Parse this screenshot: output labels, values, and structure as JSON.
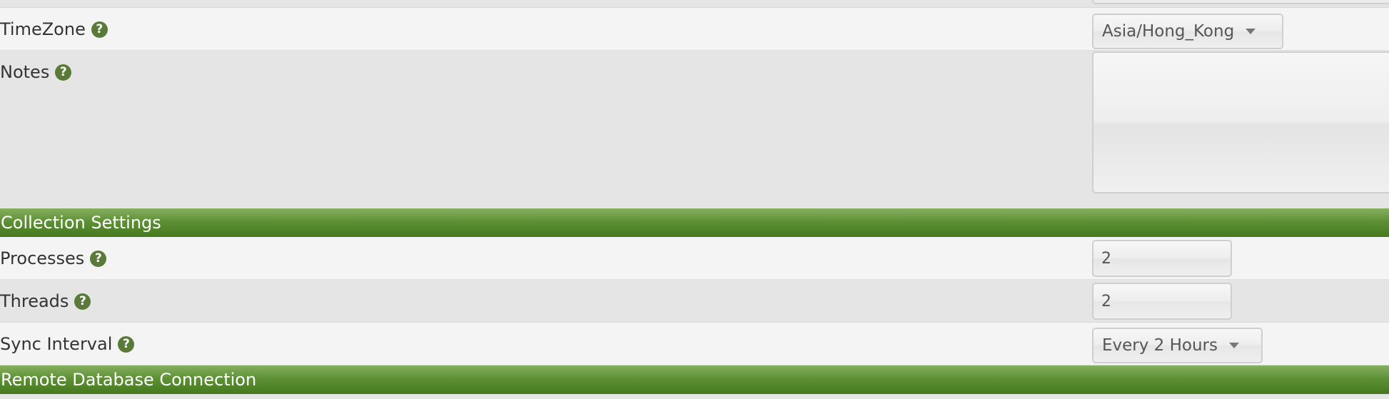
{
  "general": {
    "timezone_label": "TimeZone",
    "timezone_value": "Asia/Hong_Kong",
    "notes_label": "Notes",
    "notes_value": ""
  },
  "collection": {
    "title": "Collection Settings",
    "processes_label": "Processes",
    "processes_value": "2",
    "threads_label": "Threads",
    "threads_value": "2",
    "sync_label": "Sync Interval",
    "sync_value": "Every 2 Hours"
  },
  "remote": {
    "title": "Remote Database Connection"
  },
  "icons": {
    "help": "?",
    "help_icon_name": "question-circle-icon"
  },
  "colors": {
    "section_header_top": "#86b060",
    "section_header_bottom": "#467a1e",
    "help_icon": "#5a7a3a",
    "row_light": "#f4f4f4",
    "row_dark": "#e5e5e5"
  }
}
